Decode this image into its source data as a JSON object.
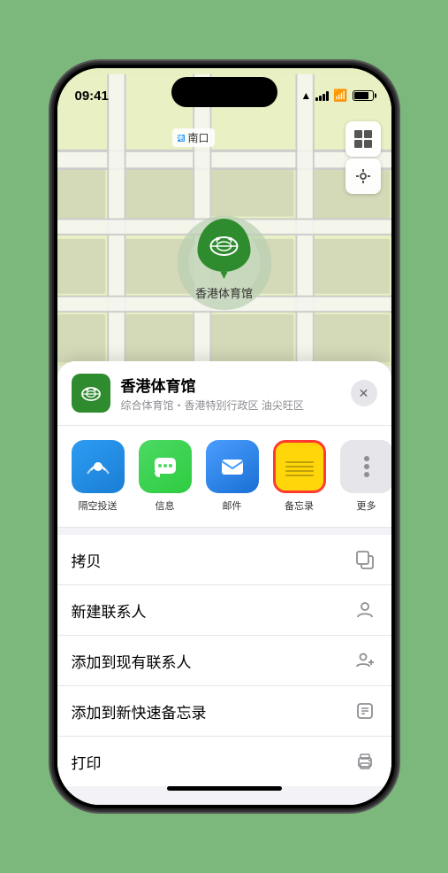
{
  "status_bar": {
    "time": "09:41",
    "location_arrow": "▲"
  },
  "map": {
    "label_text": "南口",
    "stadium_name": "香港体育馆",
    "stadium_label": "香港体育馆"
  },
  "location_card": {
    "name": "香港体育馆",
    "subtitle": "综合体育馆・香港特别行政区 油尖旺区",
    "close_label": "✕"
  },
  "share_items": [
    {
      "label": "隔空投送",
      "type": "airdrop"
    },
    {
      "label": "信息",
      "type": "message"
    },
    {
      "label": "邮件",
      "type": "mail"
    },
    {
      "label": "备忘录",
      "type": "notes"
    }
  ],
  "actions": [
    {
      "label": "拷贝",
      "icon": "copy"
    },
    {
      "label": "新建联系人",
      "icon": "person"
    },
    {
      "label": "添加到现有联系人",
      "icon": "person-add"
    },
    {
      "label": "添加到新快速备忘录",
      "icon": "note"
    },
    {
      "label": "打印",
      "icon": "print"
    }
  ]
}
